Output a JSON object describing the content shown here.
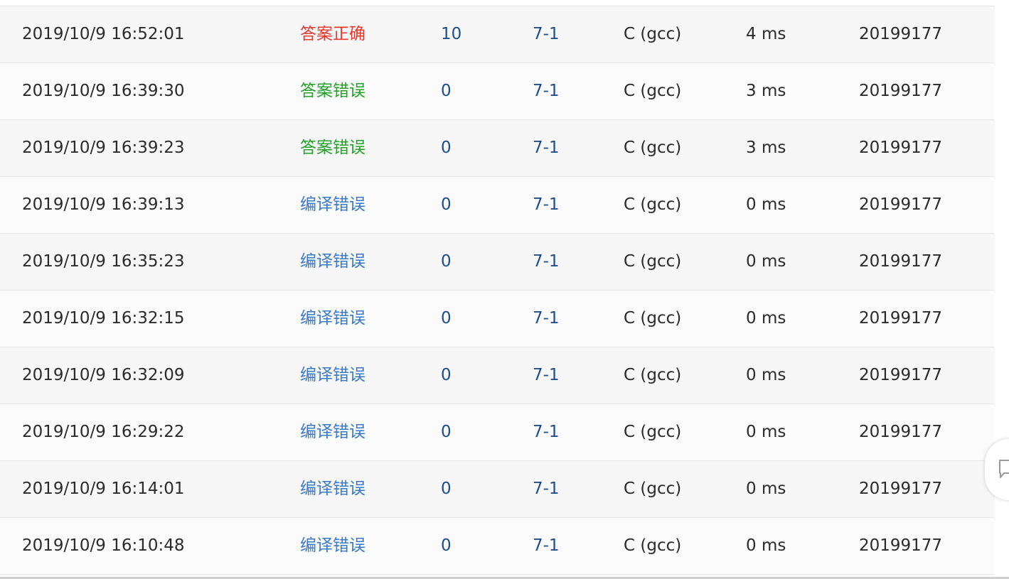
{
  "submissions": {
    "rows": [
      {
        "time": "2019/10/9 16:52:01",
        "status": "答案正确",
        "status_kind": "accepted",
        "score": "10",
        "problem": "7-1",
        "language": "C (gcc)",
        "runtime": "4 ms",
        "user": "20199177"
      },
      {
        "time": "2019/10/9 16:39:30",
        "status": "答案错误",
        "status_kind": "wrong",
        "score": "0",
        "problem": "7-1",
        "language": "C (gcc)",
        "runtime": "3 ms",
        "user": "20199177"
      },
      {
        "time": "2019/10/9 16:39:23",
        "status": "答案错误",
        "status_kind": "wrong",
        "score": "0",
        "problem": "7-1",
        "language": "C (gcc)",
        "runtime": "3 ms",
        "user": "20199177"
      },
      {
        "time": "2019/10/9 16:39:13",
        "status": "编译错误",
        "status_kind": "compile",
        "score": "0",
        "problem": "7-1",
        "language": "C (gcc)",
        "runtime": "0 ms",
        "user": "20199177"
      },
      {
        "time": "2019/10/9 16:35:23",
        "status": "编译错误",
        "status_kind": "compile",
        "score": "0",
        "problem": "7-1",
        "language": "C (gcc)",
        "runtime": "0 ms",
        "user": "20199177"
      },
      {
        "time": "2019/10/9 16:32:15",
        "status": "编译错误",
        "status_kind": "compile",
        "score": "0",
        "problem": "7-1",
        "language": "C (gcc)",
        "runtime": "0 ms",
        "user": "20199177"
      },
      {
        "time": "2019/10/9 16:32:09",
        "status": "编译错误",
        "status_kind": "compile",
        "score": "0",
        "problem": "7-1",
        "language": "C (gcc)",
        "runtime": "0 ms",
        "user": "20199177"
      },
      {
        "time": "2019/10/9 16:29:22",
        "status": "编译错误",
        "status_kind": "compile",
        "score": "0",
        "problem": "7-1",
        "language": "C (gcc)",
        "runtime": "0 ms",
        "user": "20199177"
      },
      {
        "time": "2019/10/9 16:14:01",
        "status": "编译错误",
        "status_kind": "compile",
        "score": "0",
        "problem": "7-1",
        "language": "C (gcc)",
        "runtime": "0 ms",
        "user": "20199177"
      },
      {
        "time": "2019/10/9 16:10:48",
        "status": "编译错误",
        "status_kind": "compile",
        "score": "0",
        "problem": "7-1",
        "language": "C (gcc)",
        "runtime": "0 ms",
        "user": "20199177"
      }
    ]
  },
  "colors": {
    "accepted": "#e8382e",
    "wrong": "#22a22a",
    "compile": "#3a78c9",
    "link": "#1f4e8c"
  },
  "feedback": {
    "icon": "feedback-icon"
  }
}
